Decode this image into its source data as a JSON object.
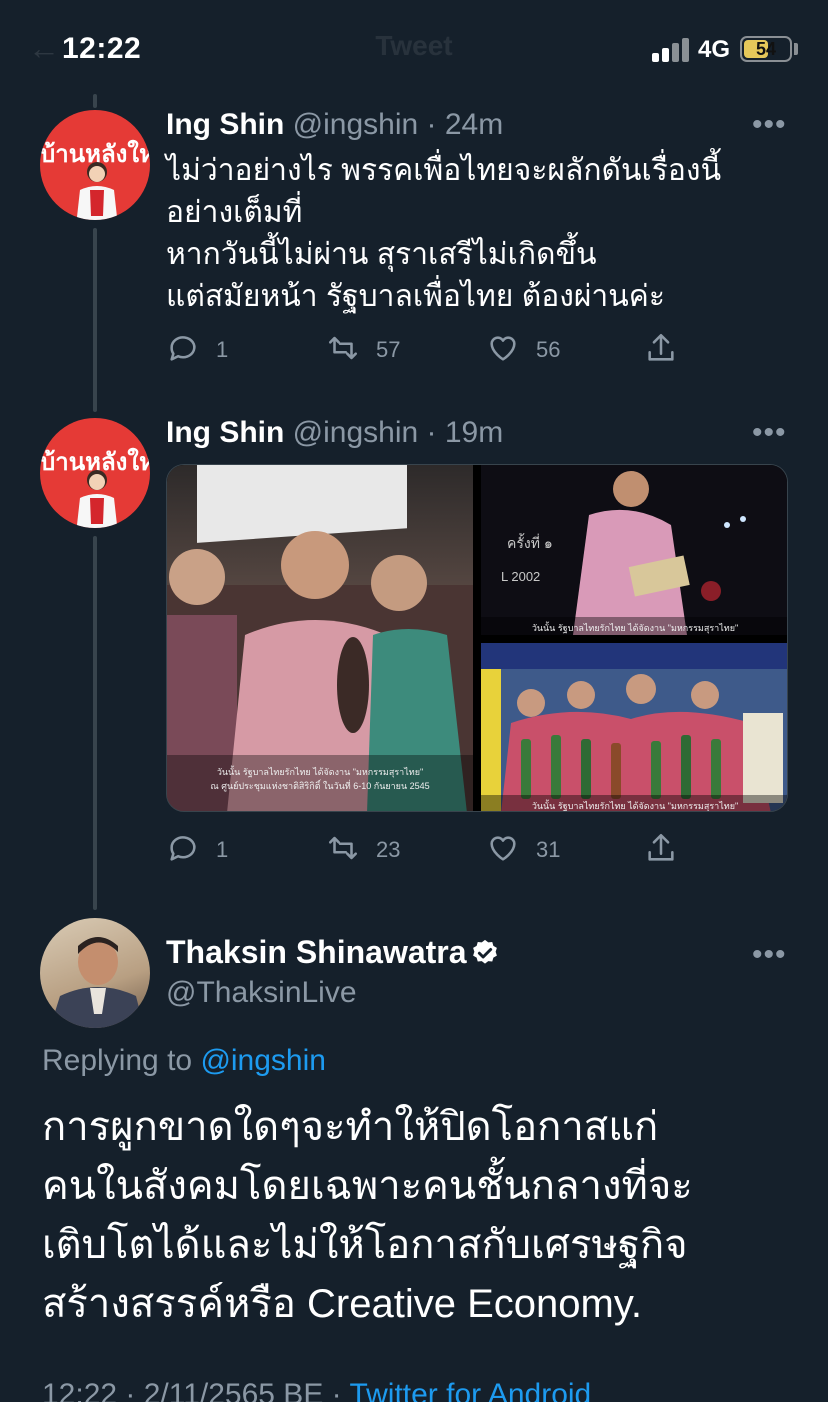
{
  "status_bar": {
    "time": "12:22",
    "network": "4G",
    "battery": "54",
    "battery_level": 0.54,
    "ghost_title": "Tweet",
    "ghost_back": "←"
  },
  "tweets": [
    {
      "name": "Ing Shin",
      "handle": "@ingshin",
      "time": "· 24m",
      "avatar_banner": "บ้านหลังใหม่",
      "text_lines": [
        "ไม่ว่าอย่างไร พรรคเพื่อไทยจะผลักดันเรื่องนี้",
        "อย่างเต็มที่",
        "หากวันนี้ไม่ผ่าน สุราเสรีไม่เกิดขึ้น",
        "แต่สมัยหน้า รัฐบาลเพื่อไทย ต้องผ่านค่ะ"
      ],
      "replies": "1",
      "retweets": "57",
      "likes": "56"
    },
    {
      "name": "Ing Shin",
      "handle": "@ingshin",
      "time": "· 19m",
      "avatar_banner": "บ้านหลังใหม่",
      "media_captions": {
        "main_line1": "วันนั้น รัฐบาลไทยรักไทย ได้จัดงาน \"มหกรรมสุราไทย\"",
        "main_line2": "ณ ศูนย์ประชุมแห่งชาติสิริกิติ์ ในวันที่ 6-10 กันยายน 2545",
        "tile2": "วันนั้น รัฐบาลไทยรักไทย ได้จัดงาน \"มหกรรมสุราไทย\"",
        "tile3": "วันนั้น รัฐบาลไทยรักไทย ได้จัดงาน \"มหกรรมสุราไทย\"",
        "tile2_sign": "ครั้งที่ ๑",
        "tile2_year": "L 2002"
      },
      "replies": "1",
      "retweets": "23",
      "likes": "31"
    }
  ],
  "main_tweet": {
    "name": "Thaksin Shinawatra",
    "handle": "@ThaksinLive",
    "replying_prefix": "Replying to ",
    "replying_to": "@ingshin",
    "text_lines": [
      "การผูกขาดใดๆจะทำให้ปิดโอกาสแก่",
      "คนในสังคมโดยเฉพาะคนชั้นกลางที่จะ",
      "เติบโตได้และไม่ให้โอกาสกับเศรษฐกิจ",
      "สร้างสรรค์หรือ Creative Economy."
    ],
    "footer_meta": "12:22 · 2/11/2565 BE · ",
    "footer_source": "Twitter for Android"
  },
  "icons": {
    "reply": "reply-icon",
    "retweet": "retweet-icon",
    "like": "heart-icon",
    "share": "share-icon",
    "more": "more-icon",
    "verified": "verified-badge-icon"
  },
  "colors": {
    "background": "#15202b",
    "secondary_text": "#8b98a5",
    "link": "#1d9bf0",
    "thread_line": "#38444d",
    "avatar_red": "#e53a36"
  }
}
